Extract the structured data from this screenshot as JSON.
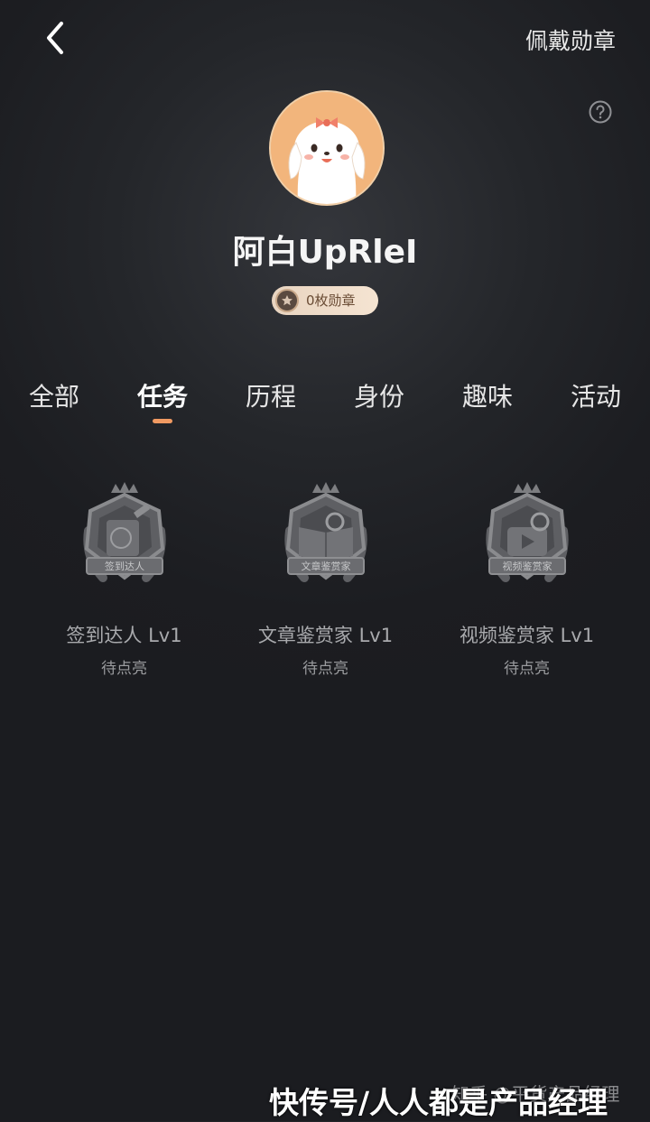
{
  "header": {
    "back_icon": "chevron-left-icon",
    "wear_label": "佩戴勋章",
    "help_icon": "question-circle-icon"
  },
  "profile": {
    "username": "阿白UpRleI",
    "badge_count_label": "0枚勋章"
  },
  "tabs": [
    {
      "label": "全部",
      "active": false
    },
    {
      "label": "任务",
      "active": true
    },
    {
      "label": "历程",
      "active": false
    },
    {
      "label": "身份",
      "active": false
    },
    {
      "label": "趣味",
      "active": false
    },
    {
      "label": "活动",
      "active": false
    }
  ],
  "medals": [
    {
      "banner": "签到达人",
      "name": "签到达人 Lv1",
      "status": "待点亮",
      "icon": "sign-in-medal-icon"
    },
    {
      "banner": "文章鉴赏家",
      "name": "文章鉴赏家 Lv1",
      "status": "待点亮",
      "icon": "article-medal-icon"
    },
    {
      "banner": "视频鉴赏家",
      "name": "视频鉴赏家 Lv1",
      "status": "待点亮",
      "icon": "video-medal-icon"
    }
  ],
  "watermark": {
    "behind": "知乎 @平货产品经理",
    "front": "快传号/人人都是产品经理"
  },
  "colors": {
    "accent": "#f09a62",
    "badge_pill_bg": "#f0dcc8",
    "avatar_bg": "#f2b57c"
  }
}
